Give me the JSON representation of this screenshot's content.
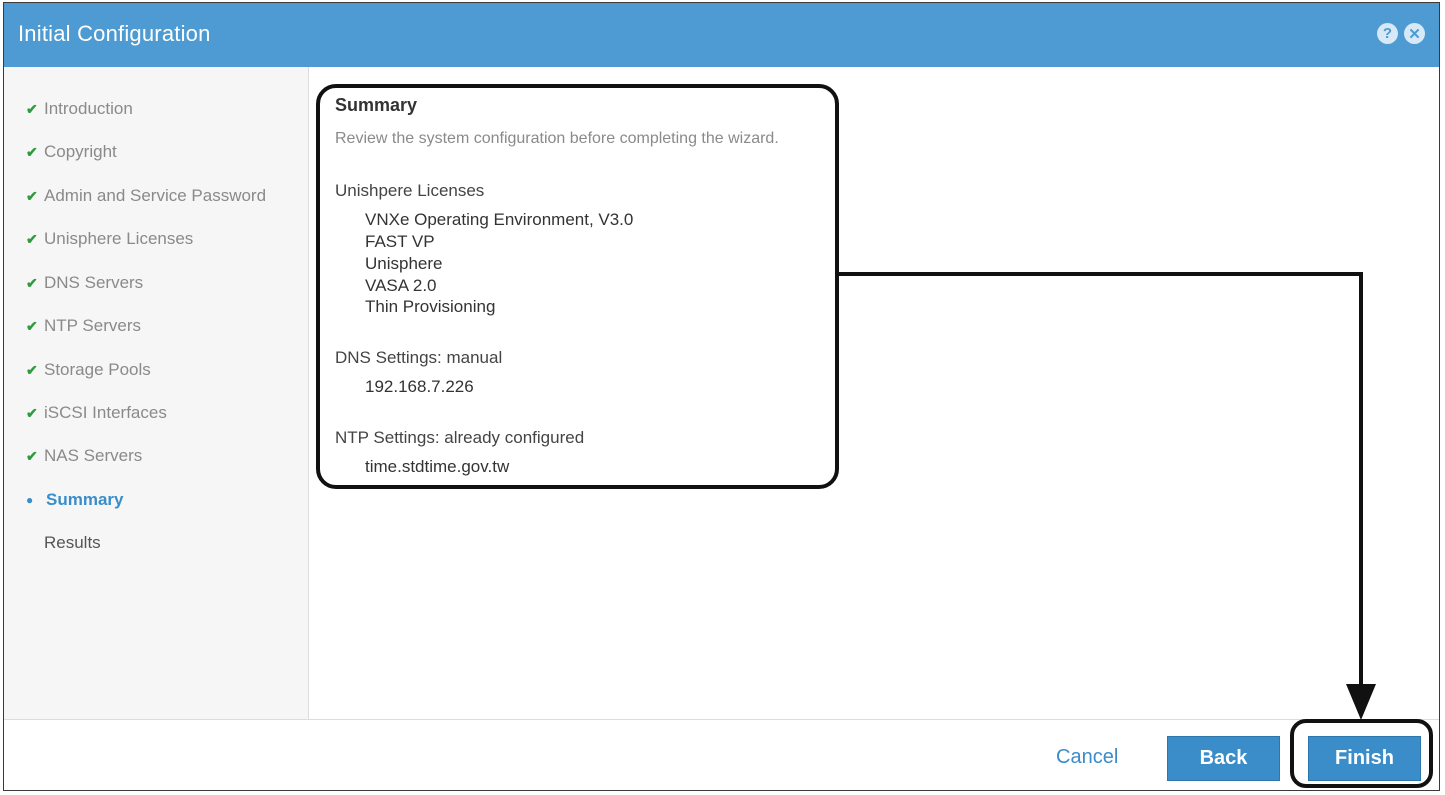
{
  "window": {
    "title": "Initial Configuration",
    "help_icon": "question-icon",
    "close_icon": "close-icon",
    "accent_color": "#4d9bd2"
  },
  "steps": [
    {
      "label": "Introduction",
      "state": "done"
    },
    {
      "label": "Copyright",
      "state": "done"
    },
    {
      "label": "Admin and Service Password",
      "state": "done"
    },
    {
      "label": "Unisphere Licenses",
      "state": "done"
    },
    {
      "label": "DNS Servers",
      "state": "done"
    },
    {
      "label": "NTP Servers",
      "state": "done"
    },
    {
      "label": "Storage Pools",
      "state": "done"
    },
    {
      "label": "iSCSI Interfaces",
      "state": "done"
    },
    {
      "label": "NAS Servers",
      "state": "done"
    },
    {
      "label": "Summary",
      "state": "current"
    },
    {
      "label": "Results",
      "state": "pending"
    }
  ],
  "summary": {
    "title": "Summary",
    "subtitle": "Review the system configuration before completing the wizard.",
    "licenses_heading": "Unishpere Licenses",
    "licenses": [
      "VNXe Operating Environment, V3.0",
      "FAST VP",
      "Unisphere",
      "VASA 2.0",
      "Thin Provisioning"
    ],
    "dns_heading": "DNS Settings: manual",
    "dns_value": "192.168.7.226",
    "ntp_heading": "NTP Settings: already configured",
    "ntp_value": "time.stdtime.gov.tw"
  },
  "footer": {
    "cancel_label": "Cancel",
    "back_label": "Back",
    "finish_label": "Finish"
  }
}
